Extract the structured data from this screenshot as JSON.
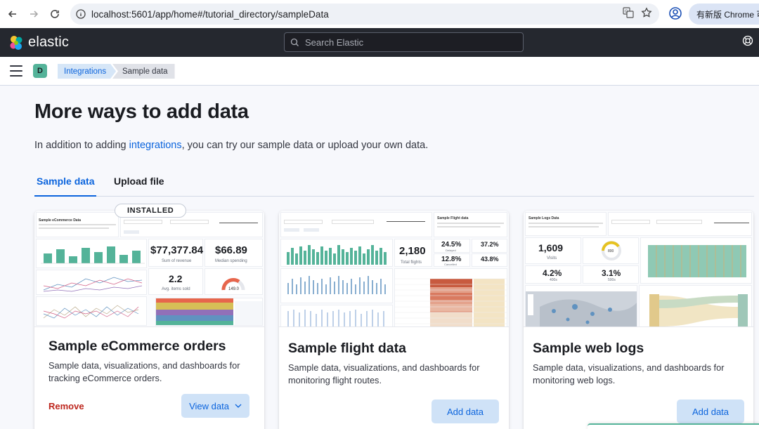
{
  "browser": {
    "url": "localhost:5601/app/home#/tutorial_directory/sampleData",
    "update_label": "有新版 Chrome 可用"
  },
  "header": {
    "logo_text": "elastic",
    "search_placeholder": "Search Elastic"
  },
  "breadcrumbs": {
    "space_initial": "D",
    "items": [
      "Integrations",
      "Sample data"
    ]
  },
  "page": {
    "title": "More ways to add data",
    "subtitle_before": "In addition to adding ",
    "subtitle_link": "integrations",
    "subtitle_after": ", you can try our sample data or upload your own data."
  },
  "tabs": [
    {
      "label": "Sample data",
      "selected": true
    },
    {
      "label": "Upload file",
      "selected": false
    }
  ],
  "cards": [
    {
      "title": "Sample eCommerce orders",
      "description": "Sample data, visualizations, and dashboards for tracking eCommerce orders.",
      "badge": "INSTALLED",
      "remove_label": "Remove",
      "primary_label": "View data",
      "preview": {
        "heading": "Sample eCommerce Data",
        "metrics": [
          {
            "value": "$77,377.84",
            "label": "Sum of revenue"
          },
          {
            "value": "$66.89",
            "label": "Median spending"
          },
          {
            "value": "2.2",
            "label": "Avg. items sold"
          },
          {
            "value": "149.0",
            "label": ""
          }
        ]
      }
    },
    {
      "title": "Sample flight data",
      "description": "Sample data, visualizations, and dashboards for monitoring flight routes.",
      "primary_label": "Add data",
      "preview": {
        "heading": "Sample Flight data",
        "metrics": [
          {
            "value": "2,180",
            "label": "Total flights"
          },
          {
            "value": "24.5%",
            "label": "Delayed"
          },
          {
            "value": "37.2%",
            "label": ""
          },
          {
            "value": "12.8%",
            "label": "Cancelled"
          },
          {
            "value": "43.8%",
            "label": ""
          }
        ]
      }
    },
    {
      "title": "Sample web logs",
      "description": "Sample data, visualizations, and dashboards for monitoring web logs.",
      "primary_label": "Add data",
      "preview": {
        "heading": "Sample Logs Data",
        "metrics": [
          {
            "value": "1,609",
            "label": "Visits"
          },
          {
            "value": "800",
            "label": ""
          },
          {
            "value": "4.2%",
            "label": "400s"
          },
          {
            "value": "3.1%",
            "label": "500s"
          }
        ]
      }
    }
  ],
  "colors": {
    "accent": "#0b64dd",
    "header_bg": "#25282f",
    "danger": "#bd271e",
    "chart_green": "#54b399"
  }
}
